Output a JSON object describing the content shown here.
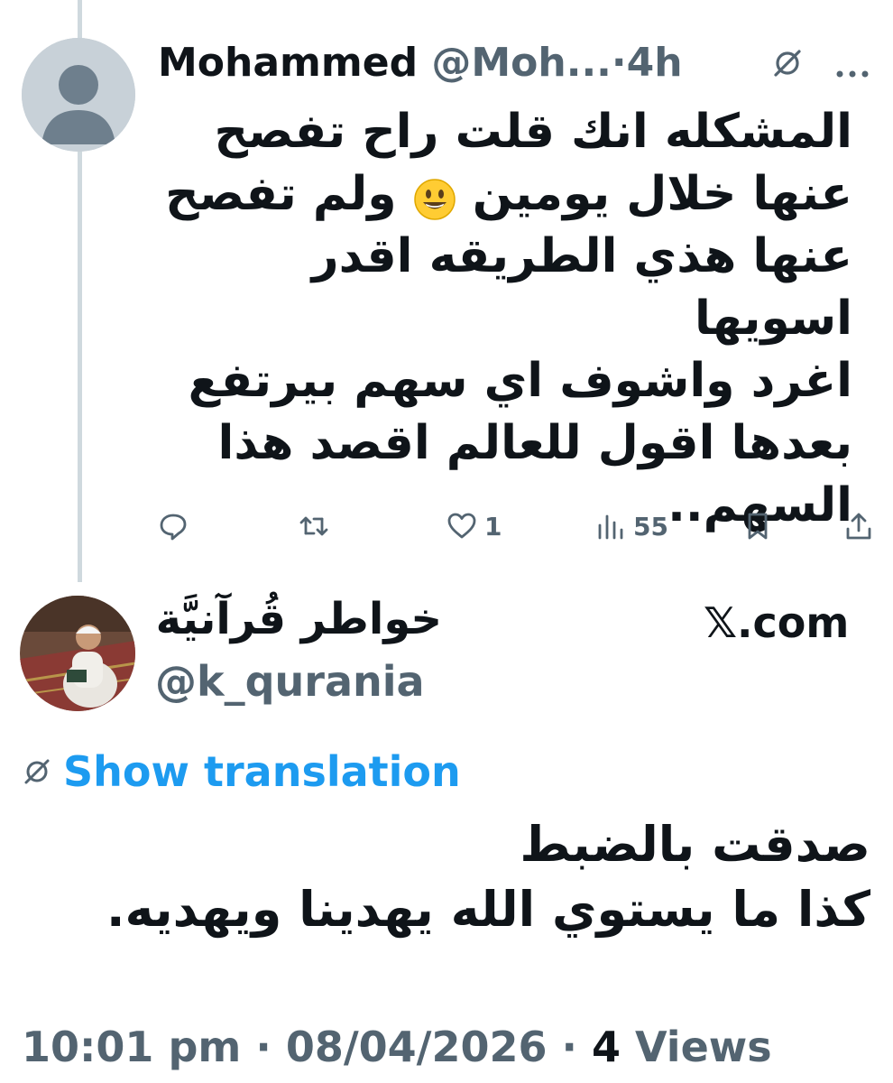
{
  "reply_tweet": {
    "author_name": "Mohammed",
    "author_handle": "@Moh...",
    "separator": "·",
    "time": "4h",
    "body_line1": "المشكله انك قلت راح تفصح",
    "body_line2_after_emoji": "ولم تفصح",
    "body_line2_before_emoji": "عنها خلال يومين",
    "body_line3": "عنها هذي الطريقه اقدر اسويها",
    "body_line4": "اغرد واشوف اي سهم بيرتفع",
    "body_line5": "بعدها اقول للعالم اقصد هذا",
    "body_line6": "السهم..",
    "emoji_name": "grinning-face-emoji",
    "actions": {
      "likes": "1",
      "views": "55"
    }
  },
  "quoted_author": {
    "name": "خواطر قُرآنيَّة",
    "handle": "@k_qurania",
    "site": "𝕏.com"
  },
  "translation_link": "Show translation",
  "main_text": {
    "line1": "صدقت بالضبط",
    "line2": "كذا ما يستوي الله يهدينا ويهديه."
  },
  "meta": {
    "time": "10:01 pm",
    "separator": "·",
    "date": "08/04/2026",
    "views_count": "4",
    "views_label": "Views"
  },
  "colors": {
    "link": "#1d9bf0",
    "muted": "#536471",
    "text": "#0f1419",
    "thread_line": "#cfd9de"
  }
}
